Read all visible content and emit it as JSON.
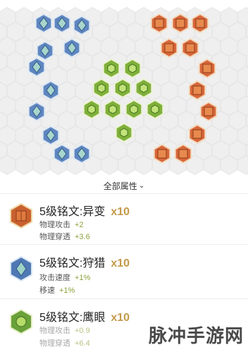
{
  "toggle": {
    "label": "全部属性",
    "chevron": "chevron-down-icon"
  },
  "colors": {
    "red": "#d8673a",
    "blue": "#5f86c0",
    "green": "#7fb03a",
    "count": "#c39a4b",
    "bonus": "#8aa23a"
  },
  "items": [
    {
      "title": "5级铭文:异变",
      "count": "x10",
      "stats": [
        {
          "label": "物理攻击",
          "value": "+2"
        },
        {
          "label": "物理穿透",
          "value": "+3.6"
        }
      ]
    },
    {
      "title": "5级铭文:狩猎",
      "count": "x10",
      "stats": [
        {
          "label": "攻击速度",
          "value": "+1%"
        },
        {
          "label": "移速",
          "value": "+1%"
        }
      ]
    },
    {
      "title": "5级铭文:鹰眼",
      "count": "x10",
      "stats": [
        {
          "label": "物理攻击",
          "value": "+0.9"
        },
        {
          "label": "物理穿透",
          "value": "+6.4"
        }
      ]
    }
  ],
  "watermark": "脉冲手游网"
}
